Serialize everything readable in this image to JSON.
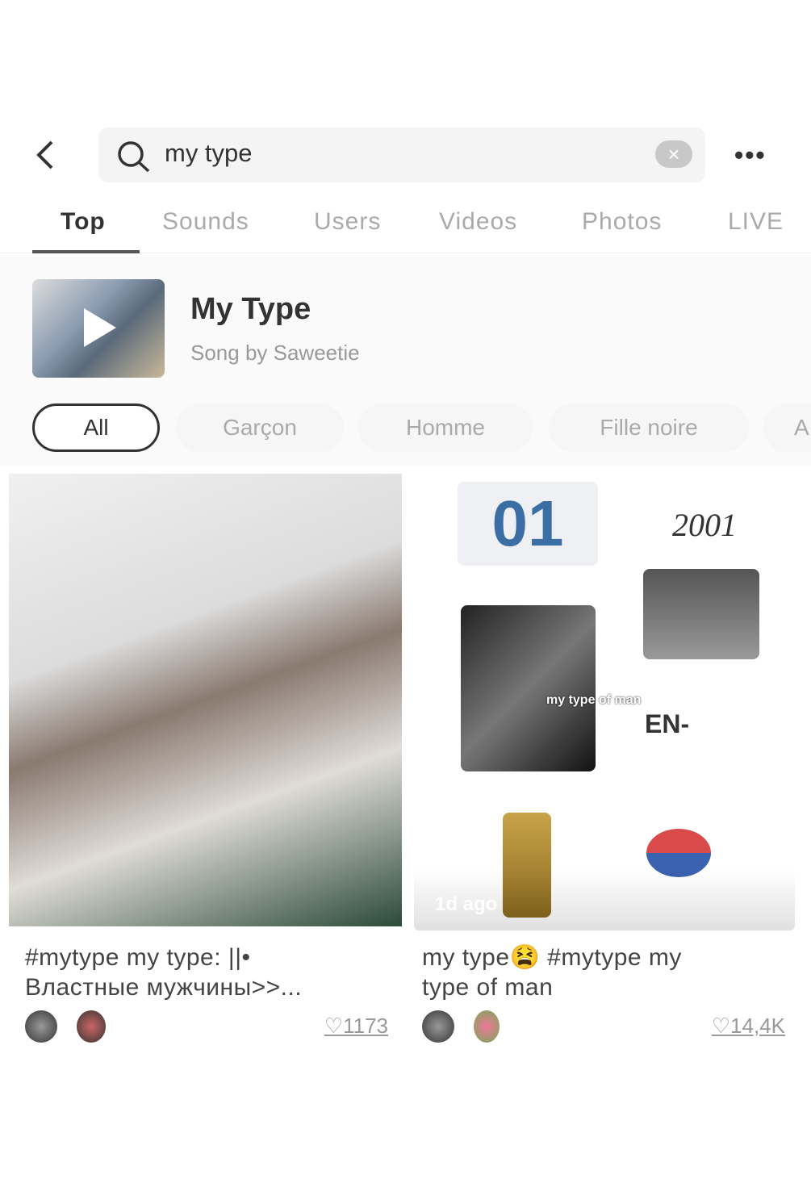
{
  "search": {
    "query": "my type",
    "icons": {
      "back": "chevron-left-icon",
      "search": "search-icon",
      "clear": "clear-icon",
      "more": "more-icon"
    },
    "more_label": "•••",
    "clear_label": "×"
  },
  "tabs": [
    {
      "label": "Top",
      "active": true
    },
    {
      "label": "Sounds"
    },
    {
      "label": "Users"
    },
    {
      "label": "Videos"
    },
    {
      "label": "Photos"
    },
    {
      "label": "LIVE"
    }
  ],
  "song": {
    "title": "My Type",
    "subtitle": "Song by Saweetie"
  },
  "chips": [
    {
      "label": "All",
      "active": true
    },
    {
      "label": "Garçon"
    },
    {
      "label": "Homme"
    },
    {
      "label": "Fille noire"
    },
    {
      "label": "A"
    }
  ],
  "videos": [
    {
      "caption_line1": "#mytype my type: ||•",
      "caption_line2": "Властные мужчины>>...",
      "likes": "1173"
    },
    {
      "caption_line1": "my type😫 #mytype my",
      "caption_line2": "type of man",
      "likes": "14,4K",
      "overlay": {
        "jersey": "01",
        "year": "2001",
        "text": "my type of man",
        "logo": "EN-",
        "age": "1d ago"
      }
    }
  ]
}
